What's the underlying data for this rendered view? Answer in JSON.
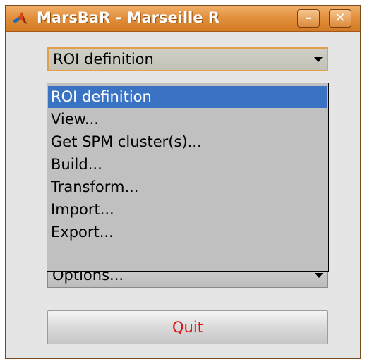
{
  "window": {
    "title": "MarsBaR - Marseille R",
    "minimize_glyph": "–",
    "close_glyph": "✕"
  },
  "roi_menu": {
    "selected": "ROI definition",
    "options": [
      "ROI definition",
      "View...",
      "Get SPM cluster(s)...",
      "Build...",
      "Transform...",
      "Import...",
      "Export..."
    ]
  },
  "options_menu": {
    "selected": "Options..."
  },
  "quit_button": {
    "label": "Quit"
  },
  "colors": {
    "titlebar": "#e3913e",
    "selection": "#3b73c4",
    "quit_text": "#e01010"
  }
}
